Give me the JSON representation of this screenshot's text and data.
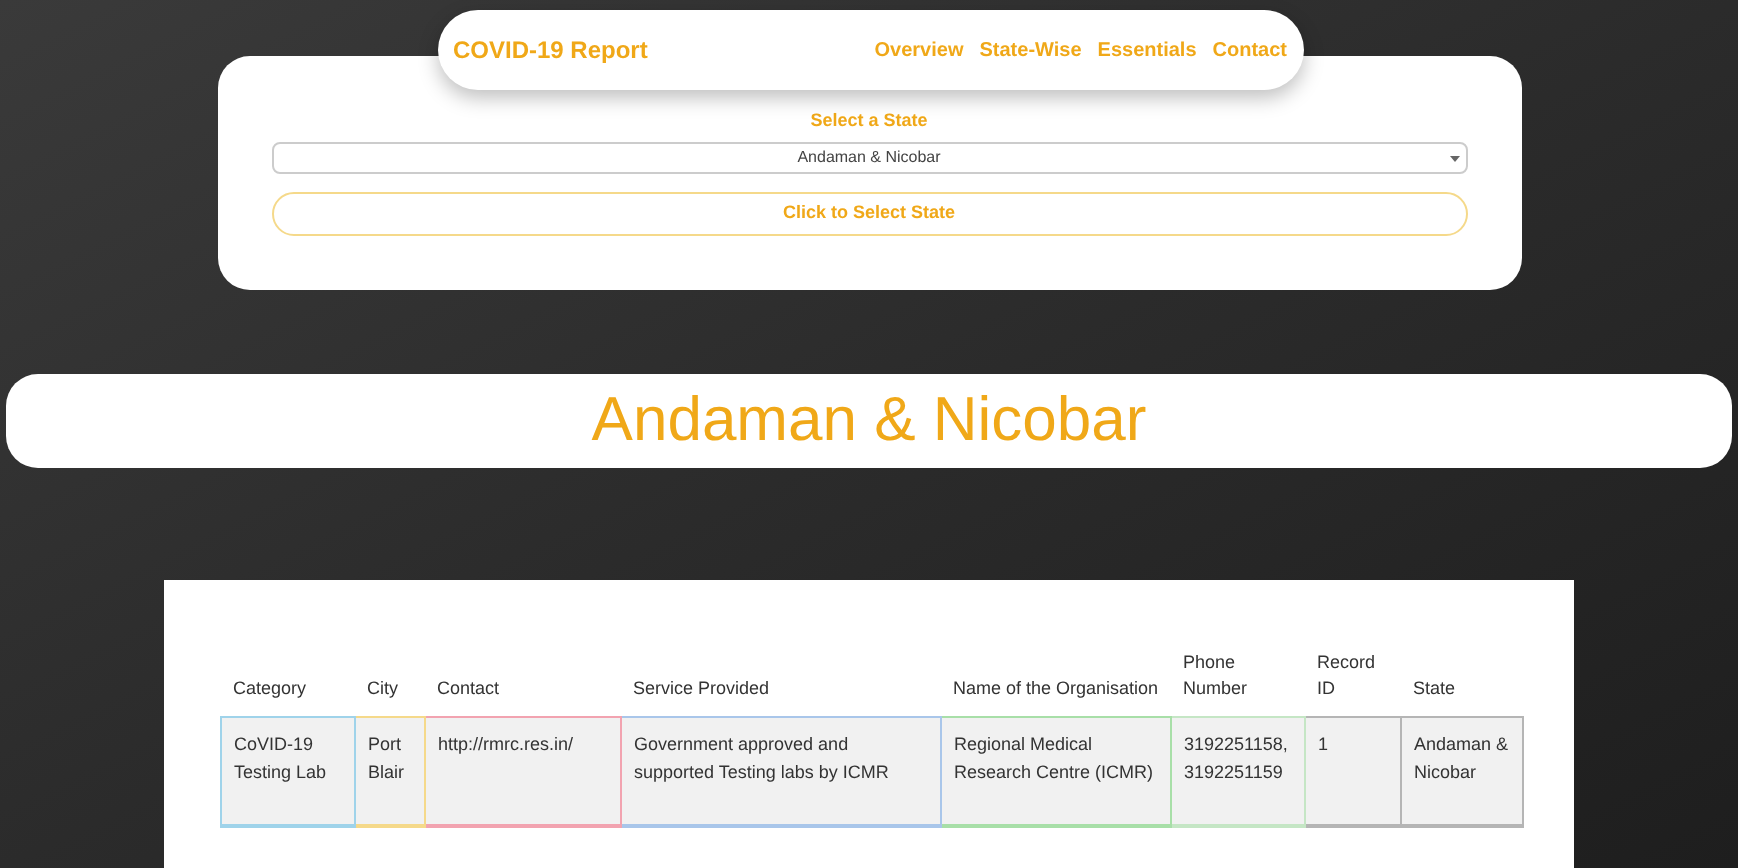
{
  "navbar": {
    "brand": "COVID-19 Report",
    "links": [
      "Overview",
      "State-Wise",
      "Essentials",
      "Contact"
    ]
  },
  "selector": {
    "label": "Select a State",
    "value": "Andaman & Nicobar",
    "button": "Click to Select State"
  },
  "banner": {
    "title": "Andaman & Nicobar"
  },
  "table": {
    "columns": [
      "Category",
      "City",
      "Contact",
      "Service Provided",
      "Name of the Organisation",
      "Phone Number",
      "Record ID",
      "State"
    ],
    "rows": [
      {
        "cells": [
          {
            "text": "CoVID-19 Testing Lab",
            "color": "#9fd3ea"
          },
          {
            "text": "Port Blair",
            "color": "#f5d98a"
          },
          {
            "text": "http://rmrc.res.in/",
            "color": "#f2a3b0"
          },
          {
            "text": "Government approved and supported Testing labs by ICMR",
            "color": "#a9c6ea"
          },
          {
            "text": "Regional Medical Research Centre (ICMR)",
            "color": "#a8dfa8"
          },
          {
            "text": "3192251158, 3192251159",
            "color": "#c5e6c5"
          },
          {
            "text": "1",
            "color": "#b5b5b5"
          },
          {
            "text": "Andaman & Nicobar",
            "color": "#b5b5b5"
          }
        ]
      }
    ]
  }
}
